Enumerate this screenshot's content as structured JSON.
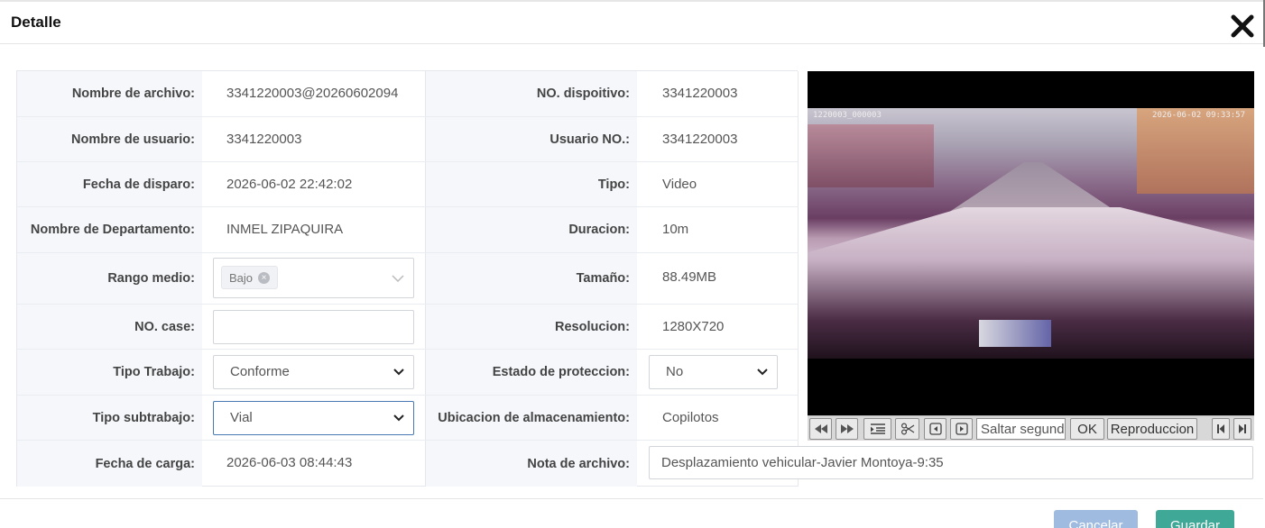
{
  "dialog": {
    "title": "Detalle",
    "close_icon": "close-icon"
  },
  "fields": {
    "nombre_archivo": {
      "label": "Nombre de archivo:",
      "value": "3341220003@20260602094"
    },
    "no_dispositivo": {
      "label": "NO. dispoitivo:",
      "value": "3341220003"
    },
    "nombre_usuario": {
      "label": "Nombre de usuario:",
      "value": "3341220003"
    },
    "usuario_no": {
      "label": "Usuario NO.:",
      "value": "3341220003"
    },
    "fecha_disparo": {
      "label": "Fecha de disparo:",
      "value": "2026-06-02 22:42:02"
    },
    "tipo": {
      "label": "Tipo:",
      "value": "Video"
    },
    "departamento": {
      "label": "Nombre de Departamento:",
      "value": "INMEL ZIPAQUIRA"
    },
    "duracion": {
      "label": "Duracion:",
      "value": "10m"
    },
    "rango_medio": {
      "label": "Rango medio:",
      "tag": "Bajo"
    },
    "tamano": {
      "label": "Tamaño:",
      "value": "88.49MB"
    },
    "no_case": {
      "label": "NO. case:",
      "value": ""
    },
    "resolucion": {
      "label": "Resolucion:",
      "value": "1280X720"
    },
    "tipo_trabajo": {
      "label": "Tipo Trabajo:",
      "value": "Conforme"
    },
    "estado_proteccion": {
      "label": "Estado de proteccion:",
      "value": "No"
    },
    "tipo_subtrabajo": {
      "label": "Tipo subtrabajo:",
      "value": "Vial"
    },
    "ubicacion": {
      "label": "Ubicacion de almacenamiento:",
      "value": "Copilotos"
    },
    "fecha_carga": {
      "label": "Fecha de carga:",
      "value": "2026-06-03 08:44:43"
    },
    "nota_archivo": {
      "label": "Nota de archivo:",
      "value": "Desplazamiento vehicular-Javier Montoya-9:35"
    }
  },
  "video": {
    "osd_left": "1220003_000003",
    "osd_right": "2026-06-02 09:33:57"
  },
  "player_toolbar": {
    "seek_placeholder": "Saltar segundos",
    "ok_label": "OK",
    "playback_label": "Reproduccion"
  },
  "footer": {
    "cancel_label": "Cancelar",
    "save_label": "Guardar"
  },
  "colors": {
    "cancel_button": "#9fbce0",
    "save_button": "#3fa896",
    "label_background": "#f5f7fa"
  }
}
